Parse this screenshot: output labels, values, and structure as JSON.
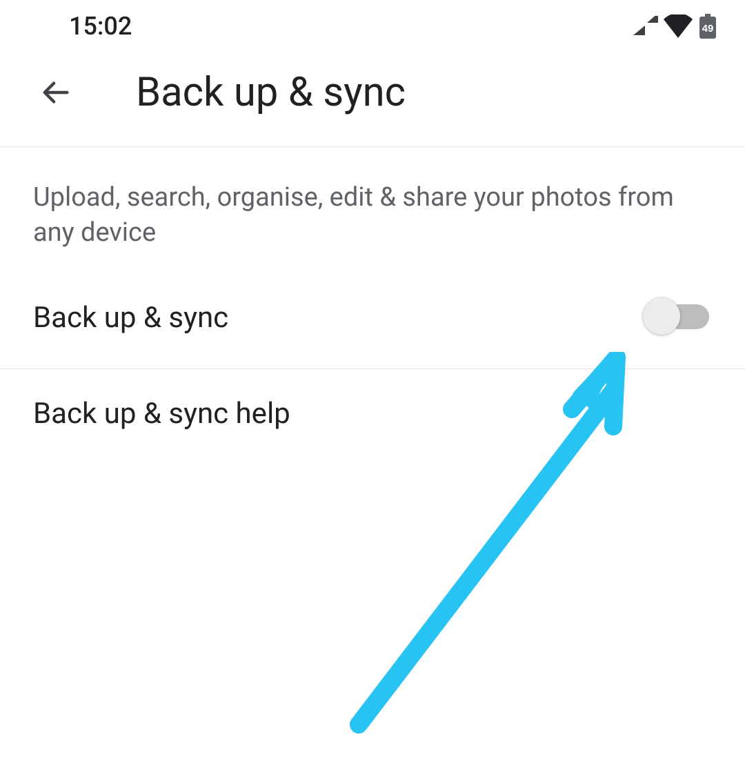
{
  "status_bar": {
    "time": "15:02",
    "battery_level": "49"
  },
  "header": {
    "title": "Back up & sync"
  },
  "description": "Upload, search, organise, edit & share your photos from any device",
  "settings": {
    "backup_sync": {
      "label": "Back up & sync",
      "value_on": false
    },
    "help": {
      "label": "Back up & sync help"
    }
  },
  "colors": {
    "annotation": "#27c3f2",
    "toggle_track_off": "#bdbdbd",
    "toggle_thumb_off": "#ececec",
    "divider": "#e4e4e4",
    "text_primary": "#202124",
    "text_secondary": "#5f6368"
  }
}
